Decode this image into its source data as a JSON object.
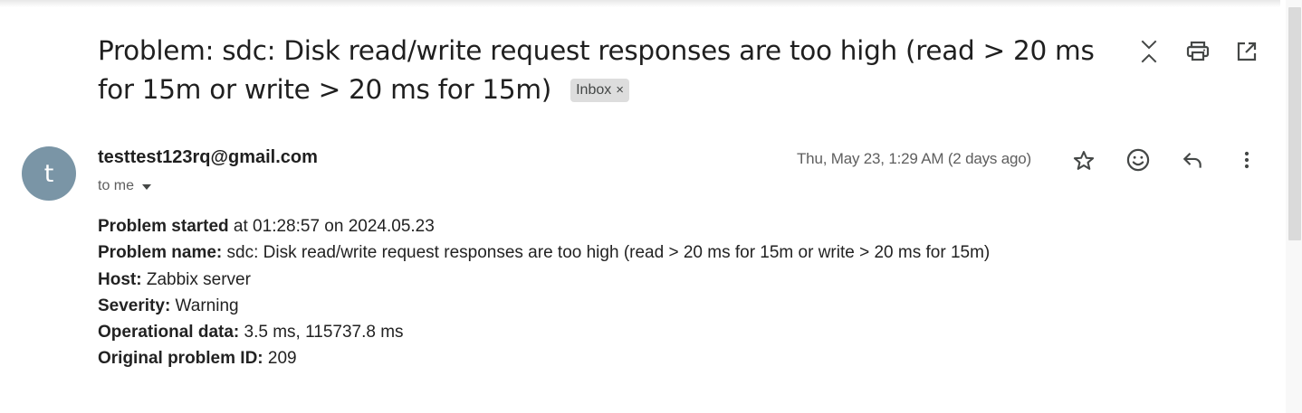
{
  "email": {
    "subject": "Problem: sdc: Disk read/write request responses are too high (read > 20 ms for 15m or write > 20 ms for 15m)",
    "label": {
      "name": "Inbox",
      "remove_glyph": "×"
    },
    "header_actions": [
      "collapse-all-icon",
      "print-icon",
      "open-in-new-window-icon"
    ],
    "sender": {
      "avatar_letter": "t",
      "avatar_color": "#7a95a6",
      "email": "testtest123rq@gmail.com",
      "to": "to me"
    },
    "date": "Thu, May 23, 1:29 AM (2 days ago)",
    "message_actions": [
      "star-icon",
      "emoji-reaction-icon",
      "reply-icon",
      "more-vert-icon"
    ],
    "body": {
      "lines": [
        {
          "label": "Problem started",
          "value": " at 01:28:57 on 2024.05.23"
        },
        {
          "label": "Problem name:",
          "value": " sdc: Disk read/write request responses are too high (read > 20 ms for 15m or write > 20 ms for 15m)"
        },
        {
          "label": "Host:",
          "value": " Zabbix server"
        },
        {
          "label": "Severity:",
          "value": " Warning"
        },
        {
          "label": "Operational data:",
          "value": " 3.5 ms, 115737.8 ms"
        },
        {
          "label": "Original problem ID:",
          "value": " 209"
        }
      ]
    }
  }
}
